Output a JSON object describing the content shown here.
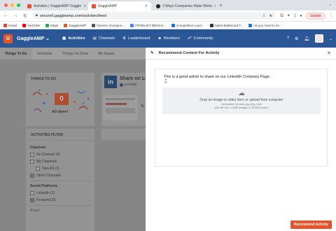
{
  "browser": {
    "tabs": [
      {
        "label": "Activities | GaggleAMP Gaggle",
        "color": "#e8542a",
        "active": false
      },
      {
        "label": "GaggleAMP",
        "color": "#e8542a",
        "active": true
      },
      {
        "label": "3 Ways Companies Make Worki",
        "color": "#222222",
        "active": false
      }
    ],
    "url": "secure6.gaggleamp.com/activities/feed",
    "update_label": "Update",
    "bookmarks": [
      {
        "label": "Gmail",
        "color": "#ea4335"
      },
      {
        "label": "YouTube",
        "color": "#ff0000"
      },
      {
        "label": "Maps",
        "color": "#34a853"
      },
      {
        "label": "GaggleAMP",
        "color": "#e8542a"
      },
      {
        "label": "Owners of respon...",
        "color": "#555555"
      },
      {
        "label": "PRODUCT BENCH...",
        "color": "#4285f4"
      },
      {
        "label": "Competitive Land...",
        "color": "#1a73e8"
      },
      {
        "label": "Sales Battlecard T...",
        "color": "#333333"
      },
      {
        "label": "All you need to kn...",
        "color": "#1a73e8"
      }
    ]
  },
  "app": {
    "brand": "GaggleAMP",
    "logo_letter": "G",
    "nav": [
      {
        "label": "Activities",
        "icon": "activities-icon",
        "selected": true
      },
      {
        "label": "Channels",
        "icon": "channels-icon",
        "selected": false
      },
      {
        "label": "Leaderboard",
        "icon": "leaderboard-icon",
        "selected": false
      },
      {
        "label": "Members",
        "icon": "members-icon",
        "selected": false
      },
      {
        "label": "Community",
        "icon": "community-icon",
        "selected": false
      }
    ],
    "subtabs": [
      "Things To Do",
      "Scheduler",
      "Things I've Done",
      "My Impact"
    ]
  },
  "left": {
    "things_to_do_title": "THINGS TO DO",
    "count": "0",
    "all_done": "All done!",
    "share_title": "Share on Lin",
    "points": "5 Points",
    "te": "Te",
    "filter_title": "ACTIVITIES FILTER",
    "filters": {
      "channels_label": "Channels",
      "items": [
        "No Channel (0)",
        "My Channels",
        "Test-AS (1)",
        "Other Channels"
      ],
      "social_label": "Social Platforms",
      "social_items": [
        "LinkedIn (1)",
        "Featured (0)"
      ],
      "reset": "Reset"
    }
  },
  "modal": {
    "title": "Recommend Content For Activity",
    "message": "This is a good article to share on our LinkedIn Company Page.",
    "drop_main": "Drop an image or video here or upload from computer",
    "drop_formats": "Acceptable formats: jpg, png, mp4",
    "drop_size": "Max file size: 10MB (image) or 200MB (video)",
    "button": "Recommend Activity"
  }
}
